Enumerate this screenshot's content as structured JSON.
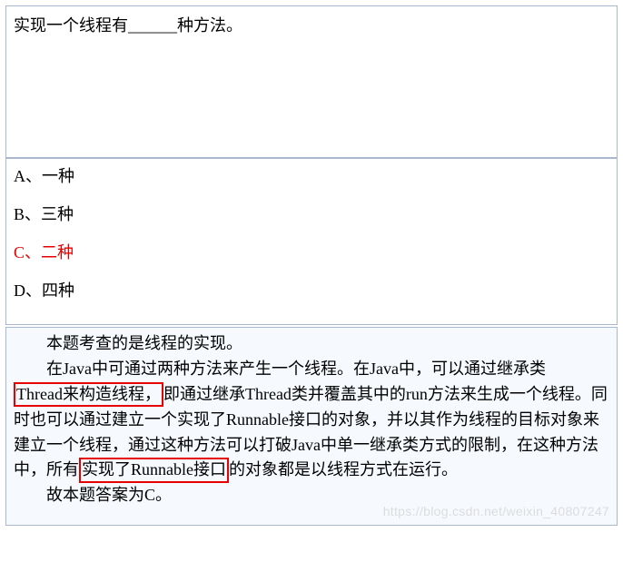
{
  "question": {
    "text": "实现一个线程有______种方法。"
  },
  "options": {
    "a": "A、一种",
    "b": "B、三种",
    "c": "C、二种",
    "d": "D、四种"
  },
  "explanation": {
    "p1": "本题考查的是线程的实现。",
    "p2a": "在Java中可通过两种方法来产生一个线程。在Java中，可以通过继承类",
    "hl1": "Thread来构造线程，",
    "p2b": "即通过继承Thread类并覆盖其中的run方法来生成一个线程。同时也可以通过建立一个实现了Runnable接口的对象，并以其作为线程的目标对象来建立一个线程，通过这种方法可以打破Java中单一继承类方式的限制，在这种方法中，所有",
    "hl2": "实现了Runnable接口",
    "p2c": "的对象都是以线程方式在运行。",
    "p3": "故本题答案为C。"
  },
  "watermark": "https://blog.csdn.net/weixin_40807247"
}
